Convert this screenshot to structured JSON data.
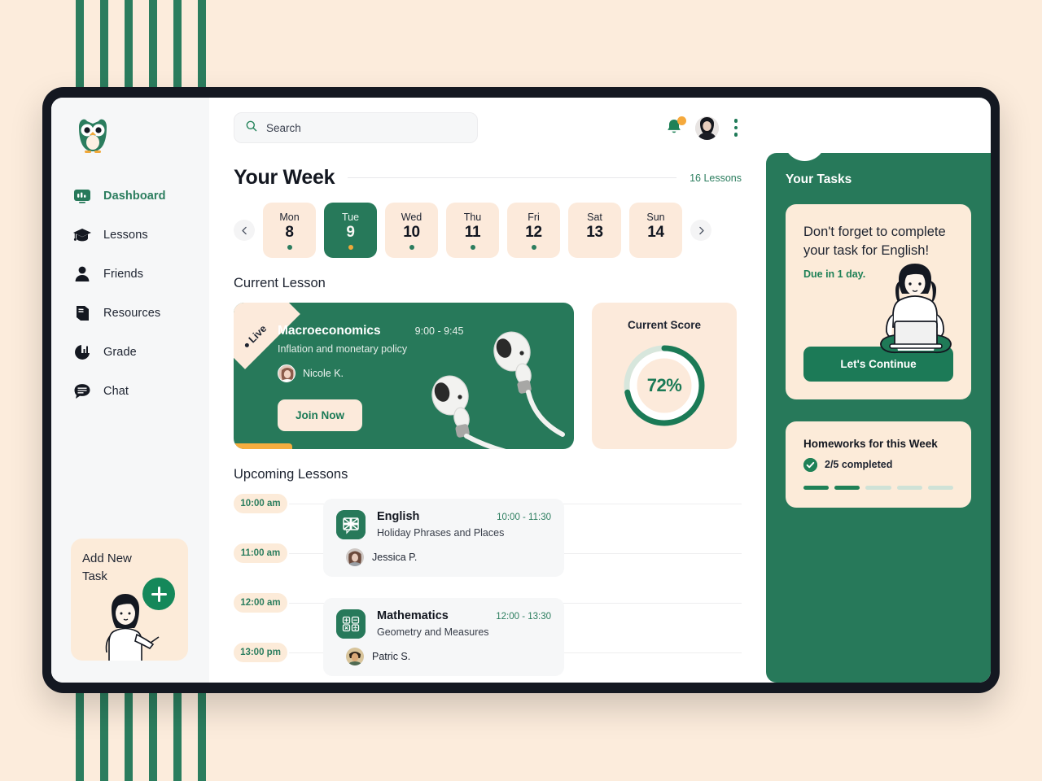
{
  "theme": {
    "page_bg": "#fcecdc",
    "stripe_green": "#2b7d5e",
    "brand_green": "#27795a",
    "accent_cream": "#fcebd9",
    "accent_orange": "#f5a93c",
    "dark": "#141821"
  },
  "background": {
    "stripe_count": 6
  },
  "sidebar": {
    "logo_name": "owl-logo",
    "items": [
      {
        "label": "Dashboard",
        "icon": "dashboard-icon",
        "active": true
      },
      {
        "label": "Lessons",
        "icon": "graduation-cap-icon",
        "active": false
      },
      {
        "label": "Friends",
        "icon": "person-icon",
        "active": false
      },
      {
        "label": "Resources",
        "icon": "book-icon",
        "active": false
      },
      {
        "label": "Grade",
        "icon": "pie-chart-icon",
        "active": false
      },
      {
        "label": "Chat",
        "icon": "chat-bubble-icon",
        "active": false
      }
    ],
    "add_task": {
      "title": "Add New Task",
      "button_icon": "plus-icon"
    }
  },
  "header": {
    "search": {
      "placeholder": "Search",
      "value": "",
      "icon": "search-icon"
    },
    "bell_icon": "notification-bell-icon",
    "bell_has_badge": true,
    "avatar": "user-avatar",
    "menu_icon": "kebab-menu-icon"
  },
  "week": {
    "title": "Your Week",
    "count": "16 Lessons",
    "prev_icon": "chevron-left-icon",
    "next_icon": "chevron-right-icon",
    "days": [
      {
        "name": "Mon",
        "num": "8",
        "selected": false,
        "dot": "green"
      },
      {
        "name": "Tue",
        "num": "9",
        "selected": true,
        "dot": "orange"
      },
      {
        "name": "Wed",
        "num": "10",
        "selected": false,
        "dot": "green"
      },
      {
        "name": "Thu",
        "num": "11",
        "selected": false,
        "dot": "green"
      },
      {
        "name": "Fri",
        "num": "12",
        "selected": false,
        "dot": "green"
      },
      {
        "name": "Sat",
        "num": "13",
        "selected": false,
        "dot": "none"
      },
      {
        "name": "Sun",
        "num": "14",
        "selected": false,
        "dot": "none"
      }
    ]
  },
  "current_lesson": {
    "section_title": "Current Lesson",
    "badge": "Live",
    "name": "Macroeconomics",
    "time": "9:00 - 9:45",
    "subtitle": "Inflation and monetary policy",
    "tutor": "Nicole K.",
    "cta": "Join Now",
    "progress_percent": 17
  },
  "score": {
    "title": "Current Score",
    "value": "72%",
    "percent": 72
  },
  "upcoming": {
    "section_title": "Upcoming Lessons",
    "time_slots": [
      "10:00 am",
      "11:00 am",
      "12:00 am",
      "13:00 pm"
    ],
    "lessons": [
      {
        "name": "English",
        "time": "10:00 - 11:30",
        "subtitle": "Holiday Phrases and Places",
        "tutor": "Jessica P.",
        "icon": "uk-flag-icon"
      },
      {
        "name": "Mathematics",
        "time": "12:00 - 13:30",
        "subtitle": "Geometry and Measures",
        "tutor": "Patric S.",
        "icon": "calculator-icon"
      }
    ]
  },
  "tasks": {
    "title": "Your Tasks",
    "message": "Don't forget to complete your task for English!",
    "due": "Due in 1 day.",
    "cta": "Let's Continue",
    "illustration": "woman-with-laptop-illustration"
  },
  "homeworks": {
    "title": "Homeworks for this Week",
    "status": "2/5 completed",
    "completed": 2,
    "total": 5,
    "check_icon": "check-circle-icon"
  }
}
